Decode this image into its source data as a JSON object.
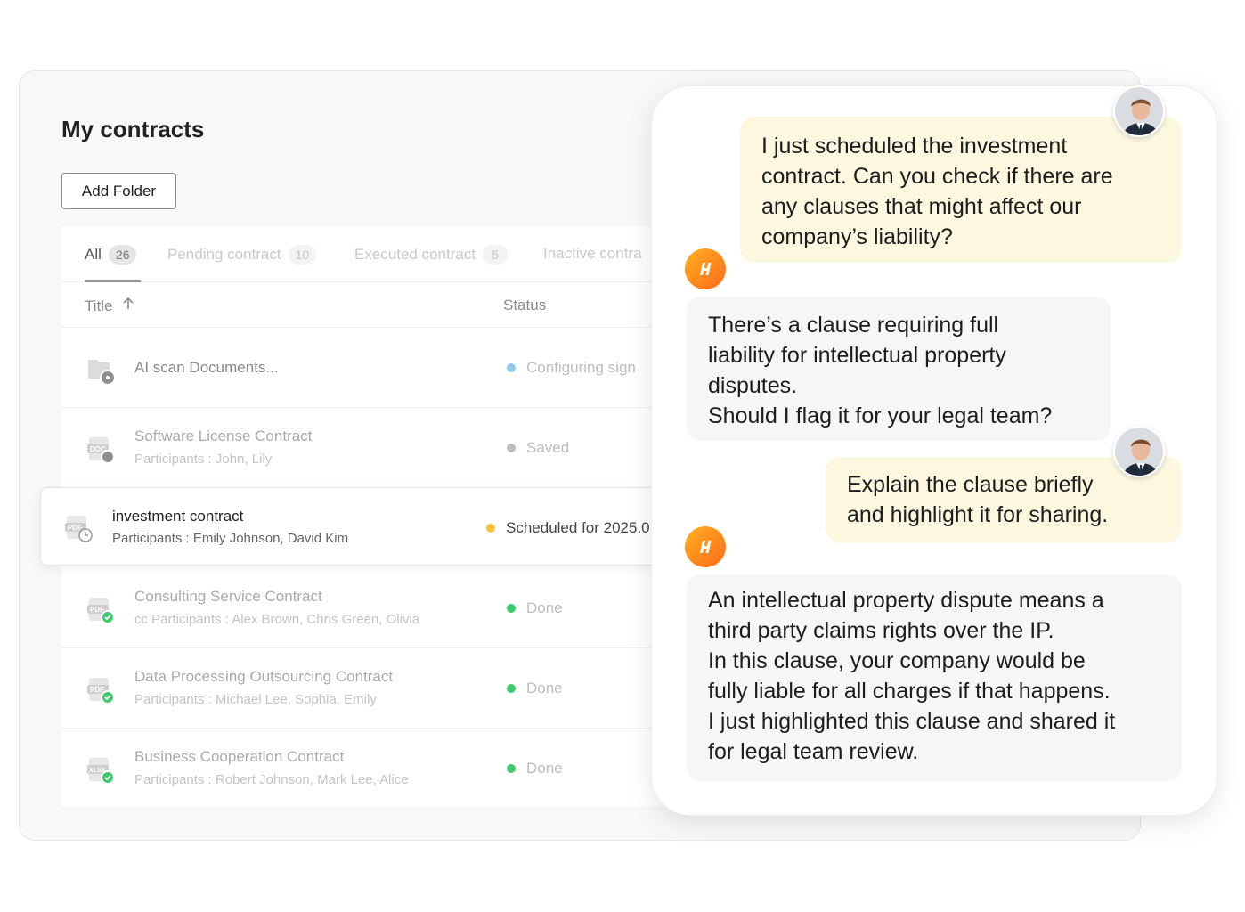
{
  "page": {
    "title": "My contracts",
    "add_folder_label": "Add Folder"
  },
  "tabs": [
    {
      "label": "All",
      "count": "26"
    },
    {
      "label": "Pending contract",
      "count": "10"
    },
    {
      "label": "Executed contract",
      "count": "5"
    },
    {
      "label": "Inactive contra"
    }
  ],
  "columns": {
    "title": "Title",
    "status": "Status"
  },
  "rows": [
    {
      "title": "AI scan Documents...",
      "participants": "",
      "status": "Configuring sign",
      "status_color": "#8ec9ee",
      "file_type": "folder"
    },
    {
      "title": "Software License Contract",
      "participants": "Participants : John, Lily",
      "status": "Saved",
      "status_color": "#bdbdbd",
      "file_type": "DOC"
    },
    {
      "title": "investment contract",
      "participants": "Participants : Emily Johnson, David Kim",
      "status": "Scheduled for 2025.0",
      "status_color": "#f7c23a",
      "file_type": "PDF"
    },
    {
      "title": "Consulting Service Contract",
      "participants": "cc Participants : Alex Brown, Chris Green, Olivia",
      "status": "Done",
      "status_color": "#3ec96d",
      "file_type": "PDF"
    },
    {
      "title": "Data Processing Outsourcing Contract",
      "participants": "Participants : Michael Lee, Sophia, Emily",
      "status": "Done",
      "status_color": "#3ec96d",
      "file_type": "PDF"
    },
    {
      "title": "Business Cooperation Contract",
      "participants": "Participants : Robert Johnson, Mark Lee, Alice",
      "status": "Done",
      "status_color": "#3ec96d",
      "file_type": "XLSX"
    }
  ],
  "chat": {
    "messages": [
      {
        "role": "user",
        "lines": [
          "I just scheduled the investment",
          "contract. Can you check if there are",
          "any clauses that might affect our",
          "company’s liability?"
        ]
      },
      {
        "role": "assistant",
        "lines": [
          "There’s a clause requiring full",
          "liability for intellectual property",
          "disputes.",
          "Should I flag it for your legal team?"
        ]
      },
      {
        "role": "user",
        "lines": [
          "Explain the clause briefly",
          "and highlight it for sharing."
        ]
      },
      {
        "role": "assistant",
        "lines": [
          "An intellectual property dispute means a",
          "third party claims rights over the IP.",
          "In this clause, your company would be",
          "fully liable for all charges if that happens.",
          "I just highlighted this clause and shared it",
          "for legal team review."
        ]
      }
    ]
  },
  "colors": {
    "accent_orange": "#ff8a1e",
    "user_bubble": "#fbf8df",
    "bot_bubble": "#f6f6f6"
  }
}
